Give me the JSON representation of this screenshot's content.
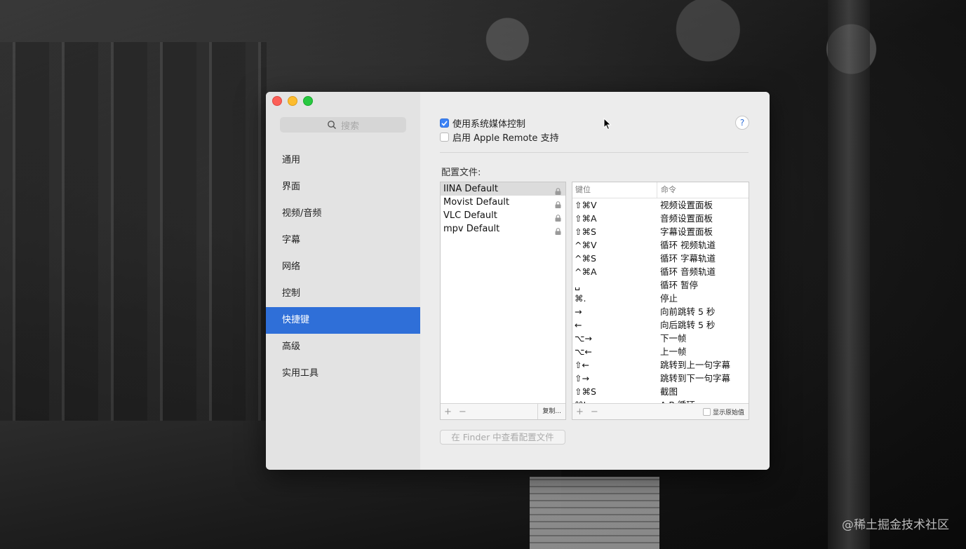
{
  "window": {
    "search_placeholder": "搜索",
    "sidebar": {
      "items": [
        {
          "label": "通用"
        },
        {
          "label": "界面"
        },
        {
          "label": "视频/音频"
        },
        {
          "label": "字幕"
        },
        {
          "label": "网络"
        },
        {
          "label": "控制"
        },
        {
          "label": "快捷键",
          "active": true
        },
        {
          "label": "高级"
        },
        {
          "label": "实用工具"
        }
      ]
    },
    "options": {
      "use_system_media": {
        "label": "使用系统媒体控制",
        "checked": true
      },
      "apple_remote": {
        "label": "启用 Apple Remote 支持",
        "checked": false
      }
    },
    "help_label": "?",
    "config_label": "配置文件:",
    "profiles": [
      {
        "name": "IINA Default",
        "selected": true
      },
      {
        "name": "Movist Default"
      },
      {
        "name": "VLC Default"
      },
      {
        "name": "mpv Default"
      }
    ],
    "profile_footer": {
      "add": "+",
      "remove": "−",
      "copy": "复制..."
    },
    "keys_table": {
      "col_key": "键位",
      "col_command": "命令",
      "rows": [
        {
          "key": "⇧⌘V",
          "command": "视频设置面板"
        },
        {
          "key": "⇧⌘A",
          "command": "音频设置面板"
        },
        {
          "key": "⇧⌘S",
          "command": "字幕设置面板"
        },
        {
          "key": "^⌘V",
          "command": "循环 视频轨道"
        },
        {
          "key": "^⌘S",
          "command": "循环 字幕轨道"
        },
        {
          "key": "^⌘A",
          "command": "循环 音频轨道"
        },
        {
          "key": "␣",
          "command": "循环 暂停"
        },
        {
          "key": "⌘.",
          "command": "停止"
        },
        {
          "key": "→",
          "command": "向前跳转 5 秒"
        },
        {
          "key": "←",
          "command": "向后跳转 5 秒"
        },
        {
          "key": "⌥→",
          "command": "下一帧"
        },
        {
          "key": "⌥←",
          "command": "上一帧"
        },
        {
          "key": "⇧←",
          "command": "跳转到上一句字幕"
        },
        {
          "key": "⇧→",
          "command": "跳转到下一句字幕"
        },
        {
          "key": "⇧⌘S",
          "command": "截图"
        },
        {
          "key": "⌘L",
          "command": "A-B 循环"
        }
      ]
    },
    "keys_footer": {
      "add": "+",
      "remove": "−",
      "show_raw": "显示原始值"
    },
    "finder_button": "在 Finder 中查看配置文件"
  },
  "credit": "@稀土掘金技术社区",
  "colors": {
    "accent": "#2f6fd8"
  }
}
